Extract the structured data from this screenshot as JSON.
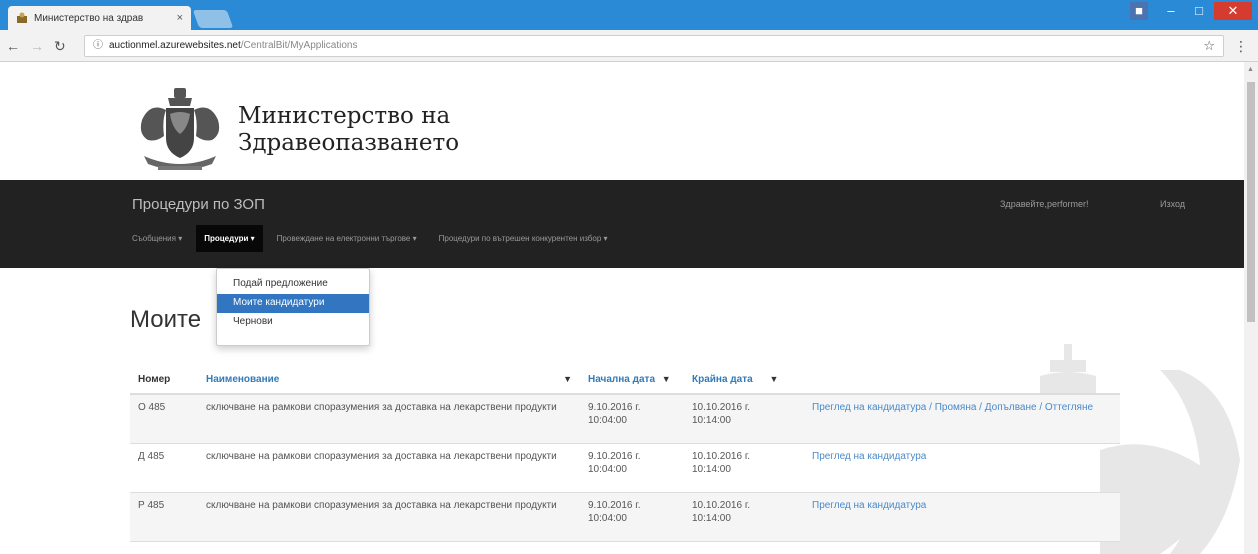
{
  "browser": {
    "tab_title": "Министерство на здрав",
    "tab_close": "×",
    "url_host": "auctionmel.azurewebsites.net",
    "url_path": "/CentralBit/MyApplications"
  },
  "site": {
    "ministry_line1": "Министерство на",
    "ministry_line2": "Здравеопазването"
  },
  "navbar": {
    "brand": "Процедури по ЗОП",
    "greeting": "Здравейте,performer!",
    "logout": "Изход",
    "menu": [
      {
        "label": "Съобщения ▾"
      },
      {
        "label": "Процедури ▾"
      },
      {
        "label": "Провеждане на електронни търгове ▾"
      },
      {
        "label": "Процедури по вътрешен конкурентен избор ▾"
      }
    ]
  },
  "dropdown": {
    "items": [
      {
        "label": "Подай предложение"
      },
      {
        "label": "Моите кандидатури"
      },
      {
        "label": "Чернови"
      }
    ]
  },
  "page": {
    "title": "Моите"
  },
  "table": {
    "headers": {
      "number": "Номер",
      "name": "Наименование",
      "start": "Начална дата",
      "end": "Крайна дата"
    },
    "rows": [
      {
        "number": "О 485",
        "name": "сключване на рамкови споразумения за доставка на лекарствени продукти",
        "start_date": "9.10.2016 г.",
        "start_time": "10:04:00",
        "end_date": "10.10.2016 г.",
        "end_time": "10:14:00",
        "links": [
          "Преглед на кандидатура",
          "Промяна",
          "Допълване",
          "Оттегляне"
        ]
      },
      {
        "number": "Д 485",
        "name": "сключване на рамкови споразумения за доставка на лекарствени продукти",
        "start_date": "9.10.2016 г.",
        "start_time": "10:04:00",
        "end_date": "10.10.2016 г.",
        "end_time": "10:14:00",
        "links": [
          "Преглед на кандидатура"
        ]
      },
      {
        "number": "Р 485",
        "name": "сключване на рамкови споразумения за доставка на лекарствени продукти",
        "start_date": "9.10.2016 г.",
        "start_time": "10:04:00",
        "end_date": "10.10.2016 г.",
        "end_time": "10:14:00",
        "links": [
          "Преглед на кандидатура"
        ]
      }
    ]
  },
  "colors": {
    "titlebar": "#2a8ad6",
    "navbar": "#222222",
    "link": "#337ab7",
    "dropdown_selected": "#3276c1"
  }
}
